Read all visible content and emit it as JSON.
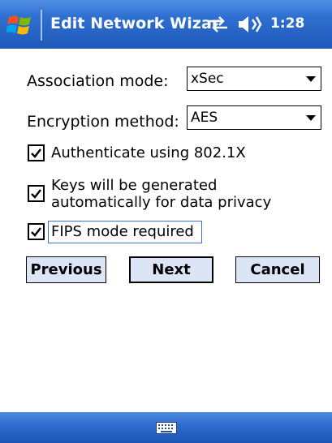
{
  "titlebar": {
    "title": "Edit Network Wizar",
    "time": "1:28",
    "icons": [
      "windows-start-icon",
      "connectivity-icon",
      "volume-icon"
    ]
  },
  "form": {
    "association_label": "Association mode:",
    "association_value": "xSec",
    "encryption_label": "Encryption method:",
    "encryption_value": "AES",
    "checkboxes": [
      {
        "label_line1": "Authenticate using 802.1X",
        "label_line2": "",
        "checked": true
      },
      {
        "label_line1": "Keys will be generated",
        "label_line2": "automatically for data privacy",
        "checked": true
      },
      {
        "label_line1": "FIPS mode required",
        "label_line2": "",
        "checked": true
      }
    ]
  },
  "buttons": {
    "previous": "Previous",
    "next": "Next",
    "cancel": "Cancel"
  },
  "bottombar": {
    "icons": [
      "keyboard-icon"
    ]
  },
  "colors": {
    "titlebar": "#2e6fd0",
    "button_face": "#dbe5f6",
    "focus_border": "#3f6ed5"
  }
}
